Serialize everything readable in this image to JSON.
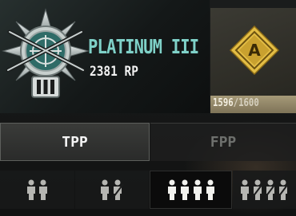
{
  "rank": {
    "name": "PLATINUM III",
    "points": "2381 RP",
    "emblem_icon": "platinum-rank-emblem-icon",
    "tier_numeral": "III",
    "name_color": "#7fd1c8"
  },
  "tier": {
    "badge_letter": "A",
    "badge_icon": "gold-diamond-badge-icon",
    "progress_current": "1596",
    "progress_max": "/1600",
    "progress_fraction": 0.9975,
    "badge_color": "#d8b33b"
  },
  "perspective_tabs": [
    {
      "label": "TPP",
      "selected": true
    },
    {
      "label": "FPP",
      "selected": false
    }
  ],
  "team_modes": [
    {
      "icon": "solo-players-icon",
      "players": 2,
      "selected": false
    },
    {
      "icon": "duo-players-icon",
      "players": 2,
      "selected": false
    },
    {
      "icon": "squad-players-icon",
      "players": 4,
      "selected": true
    },
    {
      "icon": "squad-fpp-players-icon",
      "players": 4,
      "selected": false
    }
  ]
}
